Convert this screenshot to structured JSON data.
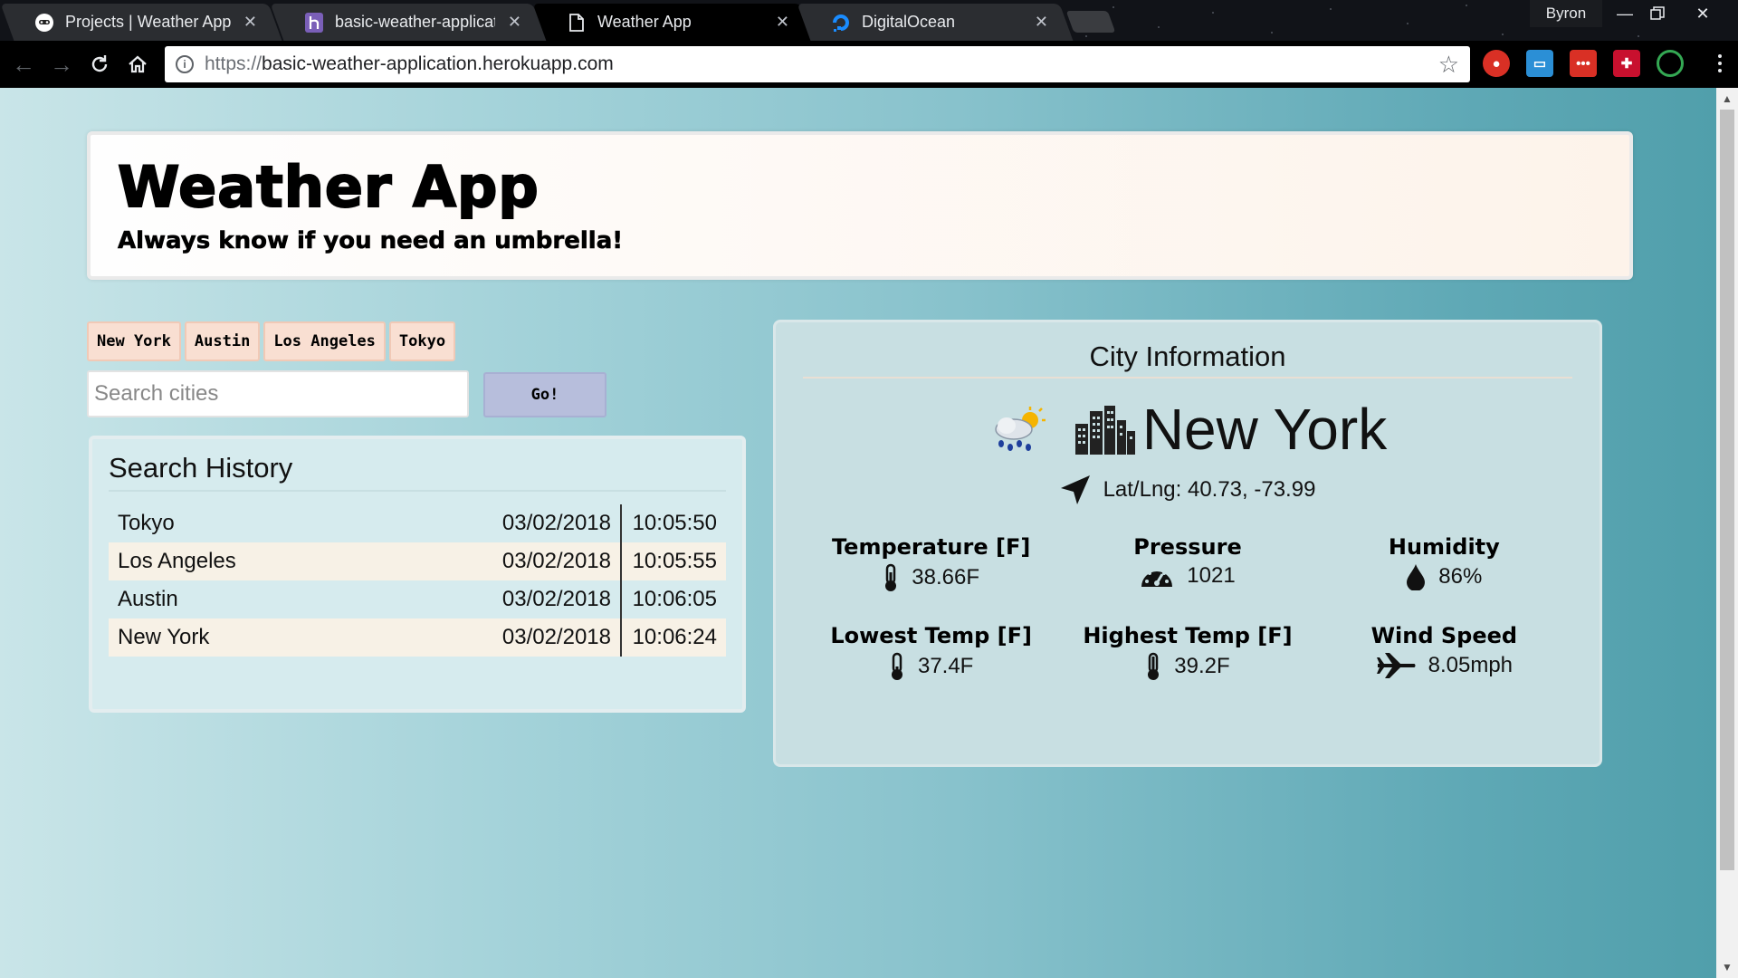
{
  "browser": {
    "tabs": [
      {
        "title": "Projects | Weather App",
        "favicon": "github-icon"
      },
      {
        "title": "basic-weather-applicatio",
        "favicon": "heroku-icon"
      },
      {
        "title": "Weather App",
        "favicon": "page-icon"
      },
      {
        "title": "DigitalOcean",
        "favicon": "digitalocean-icon"
      }
    ],
    "profile_name": "Byron",
    "url_scheme": "https://",
    "url_host": "basic-weather-application.herokuapp.com"
  },
  "header": {
    "title": "Weather App",
    "tagline": "Always know if you need an umbrella!"
  },
  "quick_cities": [
    "New York",
    "Austin",
    "Los Angeles",
    "Tokyo"
  ],
  "search": {
    "placeholder": "Search cities",
    "button_label": "Go!"
  },
  "history": {
    "title": "Search History",
    "rows": [
      {
        "city": "Tokyo",
        "date": "03/02/2018",
        "time": "10:05:50"
      },
      {
        "city": "Los Angeles",
        "date": "03/02/2018",
        "time": "10:05:55"
      },
      {
        "city": "Austin",
        "date": "03/02/2018",
        "time": "10:06:05"
      },
      {
        "city": "New York",
        "date": "03/02/2018",
        "time": "10:06:24"
      }
    ]
  },
  "city_info": {
    "title": "City Information",
    "city": "New York",
    "latlng": "Lat/Lng: 40.73, -73.99",
    "stats": {
      "temperature": {
        "label": "Temperature [F]",
        "value": "38.66F"
      },
      "pressure": {
        "label": "Pressure",
        "value": "1021"
      },
      "humidity": {
        "label": "Humidity",
        "value": "86%"
      },
      "lowest_temp": {
        "label": "Lowest Temp [F]",
        "value": "37.4F"
      },
      "highest_temp": {
        "label": "Highest Temp [F]",
        "value": "39.2F"
      },
      "wind_speed": {
        "label": "Wind Speed",
        "value": "8.05mph"
      }
    }
  },
  "colors": {
    "city_button_bg": "#f9dfd2",
    "go_button_bg": "#b7bedc",
    "history_alt_row": "#f7f1e6"
  }
}
